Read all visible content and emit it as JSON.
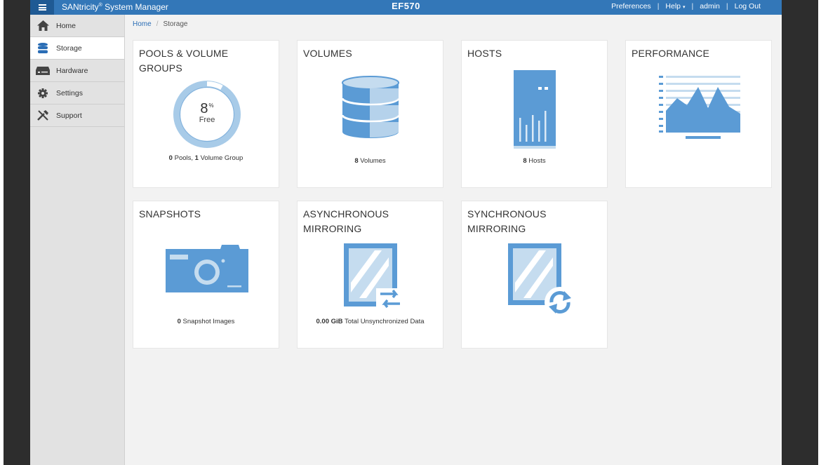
{
  "app": {
    "title": "SANtricity",
    "title_reg": "®",
    "title_suffix": " System Manager",
    "system_name": "EF570"
  },
  "topnav": {
    "preferences": "Preferences",
    "help": "Help",
    "user": "admin",
    "logout": "Log Out",
    "separator": "|",
    "caret": "▾"
  },
  "sidebar": {
    "items": [
      {
        "label": "Home",
        "icon": "home-icon"
      },
      {
        "label": "Storage",
        "icon": "storage-icon",
        "active": true
      },
      {
        "label": "Hardware",
        "icon": "hardware-icon"
      },
      {
        "label": "Settings",
        "icon": "gear-icon"
      },
      {
        "label": "Support",
        "icon": "tools-icon"
      }
    ]
  },
  "breadcrumb": {
    "home": "Home",
    "sep": "/",
    "current": "Storage"
  },
  "tiles": {
    "pools": {
      "title": "POOLS & VOLUME GROUPS",
      "percent": "8",
      "percent_sign": "%",
      "free_label": "Free",
      "free_fraction": 0.08,
      "pools_count": "0",
      "pools_label": " Pools, ",
      "vg_count": "1",
      "vg_label": " Volume Group"
    },
    "volumes": {
      "title": "VOLUMES",
      "count": "8",
      "label": " Volumes"
    },
    "hosts": {
      "title": "HOSTS",
      "count": "8",
      "label": " Hosts"
    },
    "performance": {
      "title": "PERFORMANCE"
    },
    "snapshots": {
      "title": "SNAPSHOTS",
      "count": "0",
      "label": " Snapshot Images"
    },
    "async": {
      "title": "ASYNCHRONOUS MIRRORING",
      "value": "0.00 GiB",
      "label": " Total Unsynchronized Data"
    },
    "sync": {
      "title": "SYNCHRONOUS MIRRORING"
    }
  },
  "colors": {
    "topbar": "#3377b8",
    "accent": "#5b9bd5",
    "light_accent": "#c5dcef",
    "frame": "#2d2d2d"
  }
}
